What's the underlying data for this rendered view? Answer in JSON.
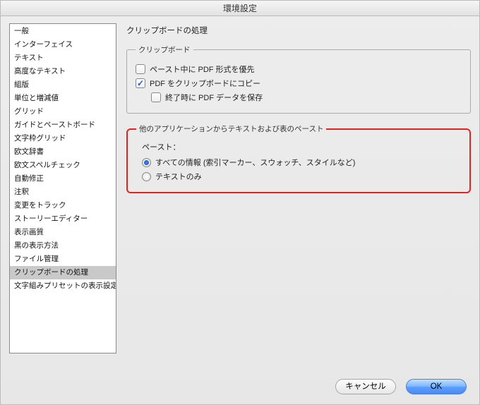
{
  "window": {
    "title": "環境設定"
  },
  "sidebar": {
    "items": [
      {
        "label": "一般"
      },
      {
        "label": "インターフェイス"
      },
      {
        "label": "テキスト"
      },
      {
        "label": "高度なテキスト"
      },
      {
        "label": "組版"
      },
      {
        "label": "単位と増減値"
      },
      {
        "label": "グリッド"
      },
      {
        "label": "ガイドとペーストボード"
      },
      {
        "label": "文字枠グリッド"
      },
      {
        "label": "欧文辞書"
      },
      {
        "label": "欧文スペルチェック"
      },
      {
        "label": "自動修正"
      },
      {
        "label": "注釈"
      },
      {
        "label": "変更をトラック"
      },
      {
        "label": "ストーリーエディター"
      },
      {
        "label": "表示画質"
      },
      {
        "label": "黒の表示方法"
      },
      {
        "label": "ファイル管理"
      },
      {
        "label": "クリップボードの処理",
        "selected": true
      },
      {
        "label": "文字組みプリセットの表示設定"
      }
    ]
  },
  "main": {
    "heading": "クリップボードの処理",
    "clipboard": {
      "legend": "クリップボード",
      "prefer_pdf": {
        "label": "ペースト中に PDF 形式を優先",
        "checked": false
      },
      "copy_pdf": {
        "label": "PDF をクリップボードにコピー",
        "checked": true
      },
      "preserve_pdf_on_quit": {
        "label": "終了時に PDF データを保存",
        "checked": false
      }
    },
    "paste_other": {
      "legend": "他のアプリケーションからテキストおよび表のペースト",
      "paste_label": "ペースト：",
      "opt_all": {
        "label": "すべての情報 (索引マーカー、スウォッチ、スタイルなど)",
        "selected": true
      },
      "opt_text": {
        "label": "テキストのみ",
        "selected": false
      }
    }
  },
  "footer": {
    "cancel": "キャンセル",
    "ok": "OK"
  }
}
